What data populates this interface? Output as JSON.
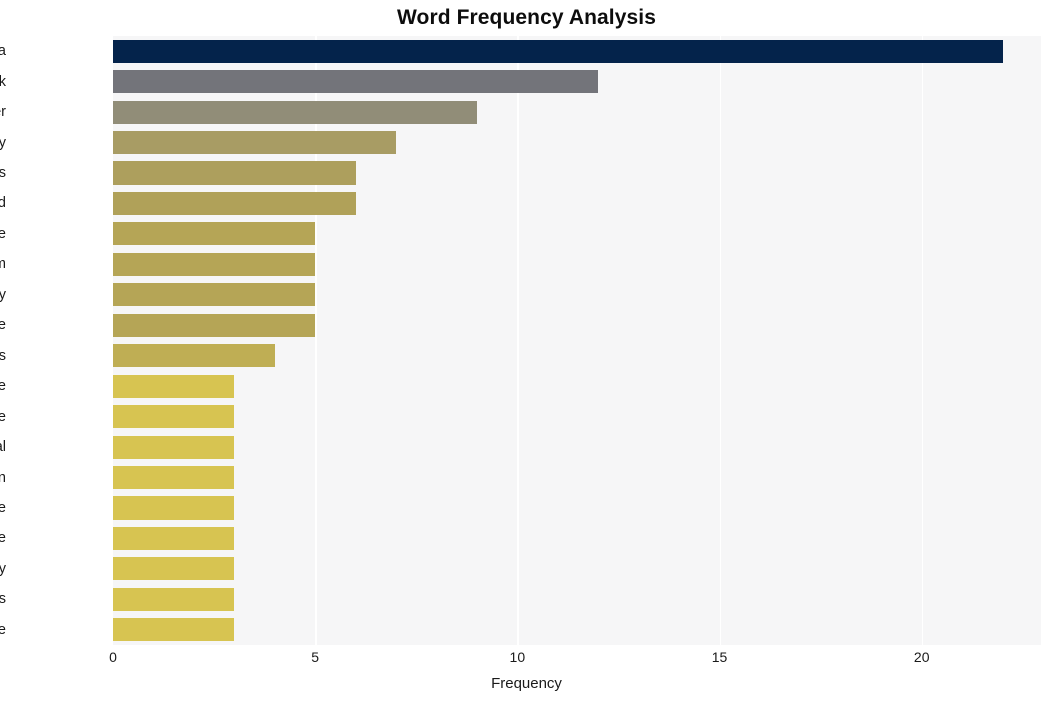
{
  "chart_data": {
    "type": "bar",
    "orientation": "horizontal",
    "title": "Word Frequency Analysis",
    "xlabel": "Frequency",
    "ylabel": "",
    "categories": [
      "data",
      "rubrik",
      "cyber",
      "security",
      "organizations",
      "cloud",
      "epe",
      "dspm",
      "recovery",
      "resilience",
      "saas",
      "live",
      "complete",
      "critical",
      "protection",
      "premise",
      "sensitive",
      "visibility",
      "capabilities",
      "posture"
    ],
    "values": [
      22,
      12,
      9,
      7,
      6,
      6,
      5,
      5,
      5,
      5,
      4,
      3,
      3,
      3,
      3,
      3,
      3,
      3,
      3,
      3
    ],
    "bar_colors": [
      "#04234b",
      "#73747a",
      "#918d78",
      "#a89c64",
      "#ad9f5d",
      "#b0a159",
      "#b5a556",
      "#b5a556",
      "#b5a556",
      "#b5a556",
      "#bfae54",
      "#d7c451",
      "#d7c451",
      "#d7c451",
      "#d7c451",
      "#d7c451",
      "#d7c451",
      "#d7c451",
      "#d7c451",
      "#d7c451"
    ],
    "xticks": [
      0,
      5,
      10,
      15,
      20
    ],
    "xtick_labels": [
      "0",
      "5",
      "10",
      "15",
      "20"
    ],
    "xlim": [
      0,
      22.95
    ],
    "grid": "vertical-white",
    "legend": "none",
    "plot_background": "#f6f6f7",
    "figure_background": "#ffffff"
  }
}
